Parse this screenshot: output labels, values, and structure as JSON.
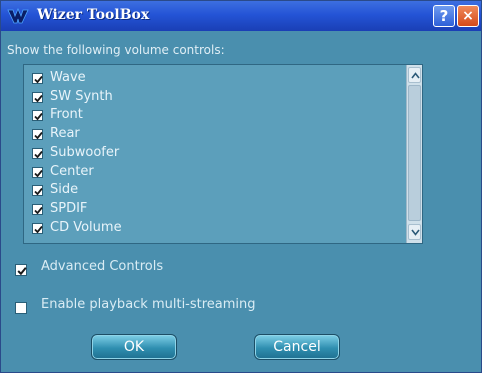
{
  "window": {
    "title": "Wizer ToolBox",
    "help_glyph": "?",
    "close_glyph": "×"
  },
  "heading": "Show the following volume controls:",
  "volume_controls": [
    {
      "label": "Wave",
      "checked": true
    },
    {
      "label": "SW Synth",
      "checked": true
    },
    {
      "label": "Front",
      "checked": true
    },
    {
      "label": "Rear",
      "checked": true
    },
    {
      "label": "Subwoofer",
      "checked": true
    },
    {
      "label": "Center",
      "checked": true
    },
    {
      "label": "Side",
      "checked": true
    },
    {
      "label": "SPDIF",
      "checked": true
    },
    {
      "label": "CD Volume",
      "checked": true
    }
  ],
  "options": {
    "advanced_controls": {
      "label": "Advanced Controls",
      "checked": true
    },
    "multistreaming": {
      "label": "Enable playback multi-streaming",
      "checked": false
    }
  },
  "buttons": {
    "ok": "OK",
    "cancel": "Cancel"
  },
  "colors": {
    "dialog_bg": "#4a8fae",
    "titlebar": "#2454d6",
    "close": "#d44a1a"
  }
}
